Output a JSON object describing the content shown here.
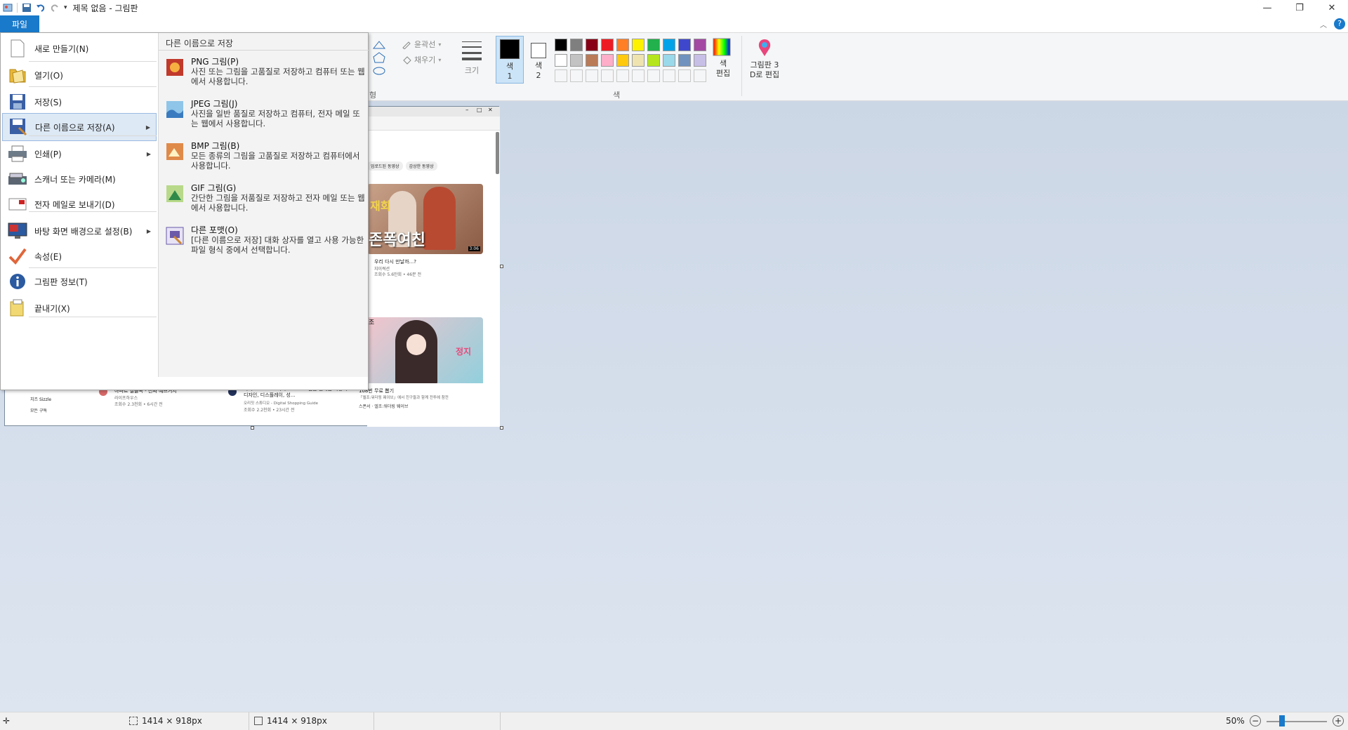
{
  "window": {
    "title": "제목 없음 - 그림판"
  },
  "ribbon": {
    "file_tab": "파일",
    "outline_label": "윤곽선",
    "fill_label": "채우기",
    "size_label": "크기",
    "color1_label": "색\n1",
    "color2_label": "색\n2",
    "colors_group": "색",
    "edit_colors": "색\n편집",
    "paint3d": "그림판 3\nD로 편집",
    "shapes_group_fragment": "형",
    "palette_row1": [
      "#000000",
      "#7f7f7f",
      "#880015",
      "#ed1c24",
      "#ff7f27",
      "#fff200",
      "#22b14c",
      "#00a2e8",
      "#3f48cc",
      "#a349a4"
    ],
    "palette_row2": [
      "#ffffff",
      "#c3c3c3",
      "#b97a57",
      "#ffaec9",
      "#ffc90e",
      "#efe4b0",
      "#b5e61d",
      "#99d9ea",
      "#7092be",
      "#c8bfe7"
    ]
  },
  "file_menu": {
    "items": [
      {
        "label": "새로 만들기(N)",
        "icon": "new-file-icon",
        "has_arrow": false
      },
      {
        "label": "열기(O)",
        "icon": "open-folder-icon",
        "has_arrow": false
      },
      {
        "label": "저장(S)",
        "icon": "save-icon",
        "has_arrow": false
      },
      {
        "label": "다른 이름으로 저장(A)",
        "icon": "save-as-icon",
        "has_arrow": true
      },
      {
        "label": "인쇄(P)",
        "icon": "printer-icon",
        "has_arrow": true
      },
      {
        "label": "스캐너 또는 카메라(M)",
        "icon": "scanner-icon",
        "has_arrow": false
      },
      {
        "label": "전자 메일로 보내기(D)",
        "icon": "email-icon",
        "has_arrow": false
      },
      {
        "label": "바탕 화면 배경으로 설정(B)",
        "icon": "desktop-background-icon",
        "has_arrow": true
      },
      {
        "label": "속성(E)",
        "icon": "checkmark-icon",
        "has_arrow": false
      },
      {
        "label": "그림판 정보(T)",
        "icon": "info-icon",
        "has_arrow": false
      },
      {
        "label": "끝내기(X)",
        "icon": "exit-icon",
        "has_arrow": false
      }
    ],
    "save_as_panel": {
      "header": "다른 이름으로 저장",
      "options": [
        {
          "title": "PNG 그림(P)",
          "desc": "사진 또는 그림을 고품질로 저장하고 컴퓨터 또는 웹에서 사용합니다.",
          "icon": "png-icon"
        },
        {
          "title": "JPEG 그림(J)",
          "desc": "사진을 일반 품질로 저장하고 컴퓨터, 전자 메일 또는 웹에서 사용합니다.",
          "icon": "jpeg-icon"
        },
        {
          "title": "BMP 그림(B)",
          "desc": "모든 종류의 그림을 고품질로 저장하고 컴퓨터에서 사용합니다.",
          "icon": "bmp-icon"
        },
        {
          "title": "GIF 그림(G)",
          "desc": "간단한 그림을 저품질로 저장하고 전자 메일 또는 웹에서 사용합니다.",
          "icon": "gif-icon"
        },
        {
          "title": "다른 포맷(O)",
          "desc": "[다른 이름으로 저장] 대화 상자를 열고 사용 가능한 파일 형식 중에서 선택합니다.",
          "icon": "other-format-icon"
        }
      ]
    }
  },
  "canvas_content": {
    "chips": [
      "업로드된 동영상",
      "감상한 동영상"
    ],
    "video1": {
      "title_overlay": "존폭여친",
      "title_top": "재회",
      "duration": "3:06",
      "caption": "우리 다시 만날까...?",
      "channel": "쟈이썩션",
      "meta": "조회수 5.6만회 • 46분 전"
    },
    "video2": {
      "badge": "정지",
      "corner": "조"
    },
    "bottom_cards": [
      {
        "title": "아파트 엘클족 - 진짜 예쁘거지",
        "channel": "라이프하우스",
        "meta": "조회수 2.3천회 • 6시간 전"
      },
      {
        "title": "마이크로소프트 서피스 프로 & 랩탑 신제품 사용기 디자인, 디스플레이, 성...",
        "channel": "오리짓 스튜디오 - Digital Shopping Guide",
        "meta": "조회수 2.2천회 • 23시간 전"
      },
      {
        "title": "108번 무료 뽑기",
        "channel": "스폰서 · 엘조:워더링 웨이브",
        "meta": "「엘조:워더링 웨이브」에서 친구들과 함께 전투에 참전"
      }
    ],
    "left_list": [
      "치즈 Sizzle",
      "모든 구독"
    ]
  },
  "status": {
    "selection_size": "1414 × 918px",
    "image_size": "1414 × 918px",
    "zoom": "50%"
  }
}
